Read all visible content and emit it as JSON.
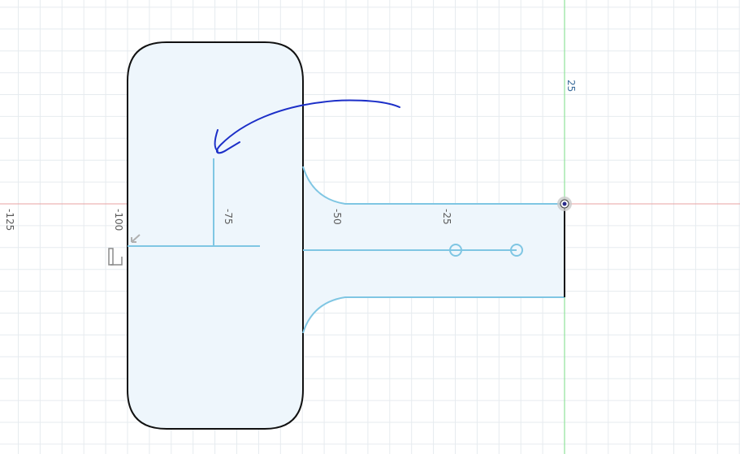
{
  "viewport": {
    "ruler_labels": {
      "x_neg125": "-125",
      "x_neg100": "-100",
      "x_neg75": "-75",
      "x_neg50": "-50",
      "x_neg25": "-25",
      "y_pos25": "25"
    },
    "colors": {
      "grid": "#e6ebef",
      "x_axis": "#e8a3a3",
      "y_axis": "#90e39a",
      "body_fill": "#eef6fc",
      "body_edge": "#111111",
      "construction": "#7fc6e3",
      "annotation_arrow": "#1c2fc8"
    },
    "icons": [
      "origin-point-icon",
      "sketch-dimension-icon",
      "constraint-marker-icon",
      "midpoint-marker-icon"
    ]
  }
}
